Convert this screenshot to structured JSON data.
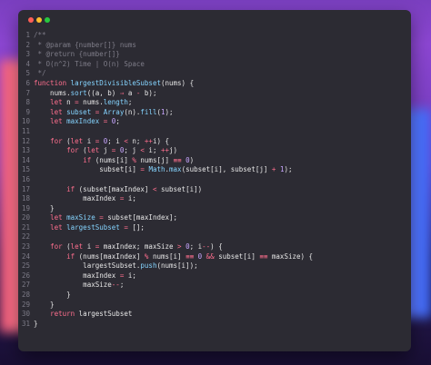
{
  "colors": {
    "window_bg": "#2c2b33",
    "close": "#ff5f56",
    "minimize": "#ffbd2e",
    "zoom": "#27c93f",
    "comment": "#7e7c88",
    "keyword": "#ff6f8e",
    "function": "#85d4ff",
    "number": "#c8a6ff",
    "text": "#e6e6e6",
    "line_number": "#7c7a86"
  },
  "window_controls": {
    "close": "close-button",
    "minimize": "minimize-button",
    "zoom": "zoom-button"
  },
  "lines": [
    {
      "n": "1",
      "tokens": [
        [
          "c",
          "/**"
        ]
      ]
    },
    {
      "n": "2",
      "tokens": [
        [
          "c",
          " * @param {number[]} nums"
        ]
      ]
    },
    {
      "n": "3",
      "tokens": [
        [
          "c",
          " * @return {number[]}"
        ]
      ]
    },
    {
      "n": "4",
      "tokens": [
        [
          "c",
          " * O(n^2) Time | O(n) Space"
        ]
      ]
    },
    {
      "n": "5",
      "tokens": [
        [
          "c",
          " */"
        ]
      ]
    },
    {
      "n": "6",
      "tokens": [
        [
          "k",
          "function "
        ],
        [
          "f",
          "largestDivisibleSubset"
        ],
        [
          "p",
          "(nums) {"
        ]
      ]
    },
    {
      "n": "7",
      "tokens": [
        [
          "p",
          "    nums."
        ],
        [
          "f",
          "sort"
        ],
        [
          "p",
          "((a, b) "
        ],
        [
          "k",
          "⇒"
        ],
        [
          "p",
          " a "
        ],
        [
          "k",
          "-"
        ],
        [
          "p",
          " b);"
        ]
      ]
    },
    {
      "n": "8",
      "tokens": [
        [
          "p",
          "    "
        ],
        [
          "k",
          "let"
        ],
        [
          "p",
          " n "
        ],
        [
          "k",
          "="
        ],
        [
          "p",
          " nums."
        ],
        [
          "f",
          "length"
        ],
        [
          "p",
          ";"
        ]
      ]
    },
    {
      "n": "9",
      "tokens": [
        [
          "p",
          "    "
        ],
        [
          "k",
          "let"
        ],
        [
          "p",
          " "
        ],
        [
          "f",
          "subset"
        ],
        [
          "p",
          " "
        ],
        [
          "k",
          "="
        ],
        [
          "p",
          " "
        ],
        [
          "f",
          "Array"
        ],
        [
          "p",
          "(n)."
        ],
        [
          "f",
          "fill"
        ],
        [
          "p",
          "("
        ],
        [
          "n",
          "1"
        ],
        [
          "p",
          ");"
        ]
      ]
    },
    {
      "n": "10",
      "tokens": [
        [
          "p",
          "    "
        ],
        [
          "k",
          "let"
        ],
        [
          "p",
          " "
        ],
        [
          "f",
          "maxIndex"
        ],
        [
          "p",
          " "
        ],
        [
          "k",
          "="
        ],
        [
          "p",
          " "
        ],
        [
          "n",
          "0"
        ],
        [
          "p",
          ";"
        ]
      ]
    },
    {
      "n": "11",
      "tokens": [
        [
          "p",
          ""
        ]
      ]
    },
    {
      "n": "12",
      "tokens": [
        [
          "p",
          "    "
        ],
        [
          "k",
          "for"
        ],
        [
          "p",
          " ("
        ],
        [
          "k",
          "let"
        ],
        [
          "p",
          " i "
        ],
        [
          "k",
          "="
        ],
        [
          "p",
          " "
        ],
        [
          "n",
          "0"
        ],
        [
          "p",
          "; i "
        ],
        [
          "k",
          "<"
        ],
        [
          "p",
          " n; "
        ],
        [
          "k",
          "++"
        ],
        [
          "p",
          "i) {"
        ]
      ]
    },
    {
      "n": "13",
      "tokens": [
        [
          "p",
          "        "
        ],
        [
          "k",
          "for"
        ],
        [
          "p",
          " ("
        ],
        [
          "k",
          "let"
        ],
        [
          "p",
          " j "
        ],
        [
          "k",
          "="
        ],
        [
          "p",
          " "
        ],
        [
          "n",
          "0"
        ],
        [
          "p",
          "; j "
        ],
        [
          "k",
          "<"
        ],
        [
          "p",
          " i; "
        ],
        [
          "k",
          "++"
        ],
        [
          "p",
          "j)"
        ]
      ]
    },
    {
      "n": "14",
      "tokens": [
        [
          "p",
          "            "
        ],
        [
          "k",
          "if"
        ],
        [
          "p",
          " (nums[i] "
        ],
        [
          "k",
          "%"
        ],
        [
          "p",
          " nums[j] "
        ],
        [
          "k",
          "≡≡"
        ],
        [
          "p",
          " "
        ],
        [
          "n",
          "0"
        ],
        [
          "p",
          ")"
        ]
      ]
    },
    {
      "n": "15",
      "tokens": [
        [
          "p",
          "                subset[i] "
        ],
        [
          "k",
          "="
        ],
        [
          "p",
          " "
        ],
        [
          "f",
          "Math"
        ],
        [
          "p",
          "."
        ],
        [
          "f",
          "max"
        ],
        [
          "p",
          "(subset[i], subset[j] "
        ],
        [
          "k",
          "+"
        ],
        [
          "p",
          " "
        ],
        [
          "n",
          "1"
        ],
        [
          "p",
          ");"
        ]
      ]
    },
    {
      "n": "16",
      "tokens": [
        [
          "p",
          ""
        ]
      ]
    },
    {
      "n": "17",
      "tokens": [
        [
          "p",
          "        "
        ],
        [
          "k",
          "if"
        ],
        [
          "p",
          " (subset[maxIndex] "
        ],
        [
          "k",
          "<"
        ],
        [
          "p",
          " subset[i])"
        ]
      ]
    },
    {
      "n": "18",
      "tokens": [
        [
          "p",
          "            maxIndex "
        ],
        [
          "k",
          "="
        ],
        [
          "p",
          " i;"
        ]
      ]
    },
    {
      "n": "19",
      "tokens": [
        [
          "p",
          "    }"
        ]
      ]
    },
    {
      "n": "20",
      "tokens": [
        [
          "p",
          "    "
        ],
        [
          "k",
          "let"
        ],
        [
          "p",
          " "
        ],
        [
          "f",
          "maxSize"
        ],
        [
          "p",
          " "
        ],
        [
          "k",
          "="
        ],
        [
          "p",
          " subset[maxIndex];"
        ]
      ]
    },
    {
      "n": "21",
      "tokens": [
        [
          "p",
          "    "
        ],
        [
          "k",
          "let"
        ],
        [
          "p",
          " "
        ],
        [
          "f",
          "largestSubset"
        ],
        [
          "p",
          " "
        ],
        [
          "k",
          "="
        ],
        [
          "p",
          " [];"
        ]
      ]
    },
    {
      "n": "22",
      "tokens": [
        [
          "p",
          ""
        ]
      ]
    },
    {
      "n": "23",
      "tokens": [
        [
          "p",
          "    "
        ],
        [
          "k",
          "for"
        ],
        [
          "p",
          " ("
        ],
        [
          "k",
          "let"
        ],
        [
          "p",
          " i "
        ],
        [
          "k",
          "="
        ],
        [
          "p",
          " maxIndex; maxSize "
        ],
        [
          "k",
          ">"
        ],
        [
          "p",
          " "
        ],
        [
          "n",
          "0"
        ],
        [
          "p",
          "; i"
        ],
        [
          "k",
          "--"
        ],
        [
          "p",
          ") {"
        ]
      ]
    },
    {
      "n": "24",
      "tokens": [
        [
          "p",
          "        "
        ],
        [
          "k",
          "if"
        ],
        [
          "p",
          " (nums[maxIndex] "
        ],
        [
          "k",
          "%"
        ],
        [
          "p",
          " nums[i] "
        ],
        [
          "k",
          "≡≡"
        ],
        [
          "p",
          " "
        ],
        [
          "n",
          "0"
        ],
        [
          "p",
          " "
        ],
        [
          "k",
          "&&"
        ],
        [
          "p",
          " subset[i] "
        ],
        [
          "k",
          "≡≡"
        ],
        [
          "p",
          " maxSize) {"
        ]
      ]
    },
    {
      "n": "25",
      "tokens": [
        [
          "p",
          "            largestSubset."
        ],
        [
          "f",
          "push"
        ],
        [
          "p",
          "(nums[i]);"
        ]
      ]
    },
    {
      "n": "26",
      "tokens": [
        [
          "p",
          "            maxIndex "
        ],
        [
          "k",
          "="
        ],
        [
          "p",
          " i;"
        ]
      ]
    },
    {
      "n": "27",
      "tokens": [
        [
          "p",
          "            maxSize"
        ],
        [
          "k",
          "--"
        ],
        [
          "p",
          ";"
        ]
      ]
    },
    {
      "n": "28",
      "tokens": [
        [
          "p",
          "        }"
        ]
      ]
    },
    {
      "n": "29",
      "tokens": [
        [
          "p",
          "    }"
        ]
      ]
    },
    {
      "n": "30",
      "tokens": [
        [
          "p",
          "    "
        ],
        [
          "k",
          "return"
        ],
        [
          "p",
          " largestSubset"
        ]
      ]
    },
    {
      "n": "31",
      "tokens": [
        [
          "p",
          "}"
        ]
      ]
    }
  ]
}
